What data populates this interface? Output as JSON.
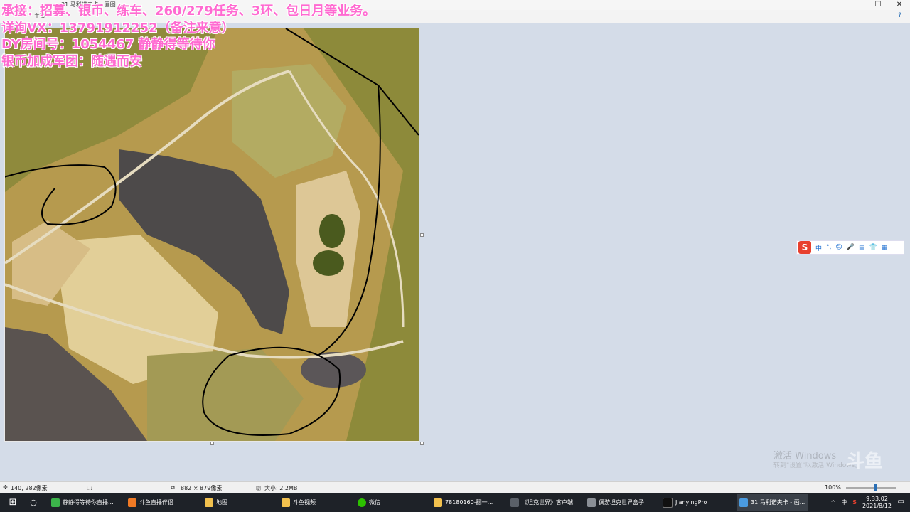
{
  "titlebar": {
    "title": "31.马利诺夫卡 - 画图",
    "controls": [
      "─",
      "☐",
      "✕"
    ]
  },
  "ribbon": {
    "visible_tab": "主页",
    "help_icon": "?"
  },
  "overlay": {
    "line1": "承接：招募、银币、练车、260/279任务、3环、包日月等业务。",
    "line2": "详询VX：13791912252（备注来意）",
    "line3": "DY房间号：1054467 静静得等待你",
    "line4": "银币加成军团：随遇而安"
  },
  "ime": {
    "logo": "S",
    "items": [
      "中",
      "°,",
      "☺",
      "🎤",
      "▤",
      "👕",
      "▦"
    ]
  },
  "watermark": {
    "line1": "激活 Windows",
    "line2": "转到\"设置\"以激活 Windows。",
    "brand": "斗鱼"
  },
  "statusbar": {
    "cursor_pos": "140, 282像素",
    "selection": "",
    "dimensions": "882 × 879像素",
    "filesize": "大小: 2.2MB",
    "zoom": "100%"
  },
  "taskbar": {
    "items": [
      {
        "label": "静静得等待你直播...",
        "color": "#3cb44b"
      },
      {
        "label": "斗鱼直播伴侣",
        "color": "#f07a25"
      },
      {
        "label": "地图",
        "color": "#f2c14e"
      },
      {
        "label": "斗鱼视频",
        "color": "#f2c14e"
      },
      {
        "label": "微信",
        "color": "#2dc100"
      },
      {
        "label": "78180160-翻一...",
        "color": "#f2c14e"
      },
      {
        "label": "《坦克世界》客户端",
        "color": "#5a6068"
      },
      {
        "label": "偶游坦克世界盒子",
        "color": "#8a8f96"
      },
      {
        "label": "JianyingPro",
        "color": "#111111"
      },
      {
        "label": "31.马利诺夫卡 - 画...",
        "color": "#4a9be0"
      }
    ],
    "tray_lang": "中",
    "time": "9:33:02",
    "date": "2021/8/12"
  },
  "colors": {
    "overlay_text": "#ff6ad1",
    "map_field": "#c9a862",
    "map_water": "#4d4a4a",
    "map_grass": "#8a8a35"
  }
}
